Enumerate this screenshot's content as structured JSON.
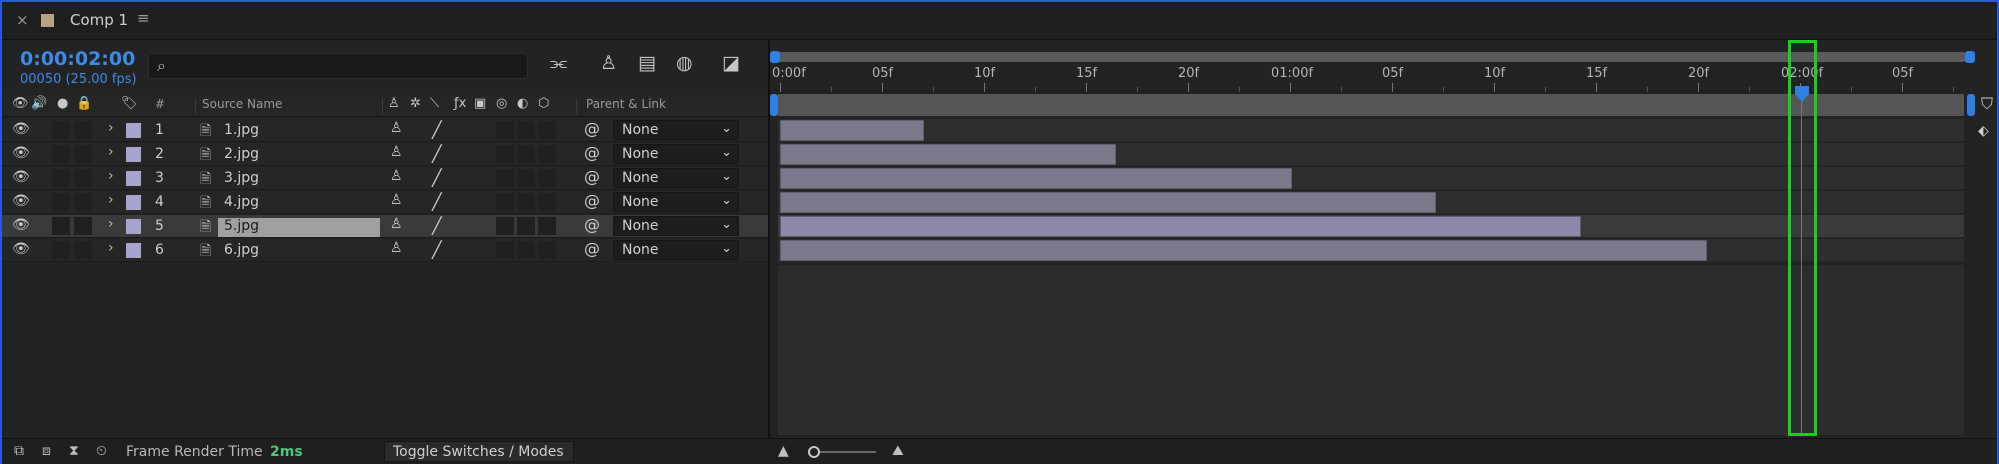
{
  "tab": {
    "title": "Comp 1",
    "close_icon": "×",
    "menu_icon": "≡"
  },
  "composition": {
    "timecode": "0:00:02:00",
    "frame_info": "00050 (25.00 fps)"
  },
  "search": {
    "placeholder": ""
  },
  "columns": {
    "hash": "#",
    "source_name": "Source Name",
    "parent_link": "Parent & Link"
  },
  "layers": [
    {
      "number": "1",
      "name": "1.jpg",
      "parent": "None",
      "selected": false,
      "duration_fraction": 0.121
    },
    {
      "number": "2",
      "name": "2.jpg",
      "parent": "None",
      "selected": false,
      "duration_fraction": 0.283
    },
    {
      "number": "3",
      "name": "3.jpg",
      "parent": "None",
      "selected": false,
      "duration_fraction": 0.432
    },
    {
      "number": "4",
      "name": "4.jpg",
      "parent": "None",
      "selected": false,
      "duration_fraction": 0.553
    },
    {
      "number": "5",
      "name": "5.jpg",
      "parent": "None",
      "selected": true,
      "duration_fraction": 0.675
    },
    {
      "number": "6",
      "name": "6.jpg",
      "parent": "None",
      "selected": false,
      "duration_fraction": 0.782
    }
  ],
  "ruler": {
    "labels": [
      "0:00f",
      "05f",
      "10f",
      "15f",
      "20f",
      "01:00f",
      "05f",
      "10f",
      "15f",
      "20f",
      "02:00f",
      "05f"
    ]
  },
  "playhead": {
    "label": "02:00f"
  },
  "bottom": {
    "frame_render_label": "Frame Render Time",
    "frame_render_value": "2ms",
    "toggle_label": "Toggle Switches / Modes"
  },
  "colors": {
    "accent": "#3d8be8",
    "layer_label": "#a7a3cf",
    "highlight": "#19d119",
    "render_value": "#4fc67d"
  }
}
